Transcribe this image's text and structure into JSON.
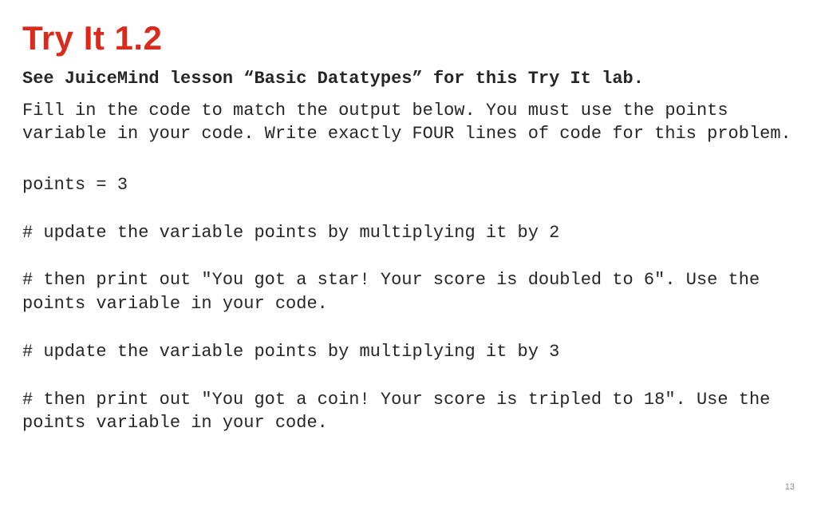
{
  "title": "Try It 1.2",
  "subhead": "See JuiceMind lesson “Basic Datatypes” for this Try It lab.",
  "body": "Fill in the code to match the output below. You must use the points variable in your code. Write exactly FOUR lines of code for this problem.",
  "code": {
    "line1": "points = 3",
    "line2": "# update the variable points by multiplying it by 2",
    "line3": "# then print out \"You got a star! Your score is doubled to 6\". Use the points variable in your code.",
    "line4": "# update the variable points by multiplying it by 3",
    "line5": "# then print out \"You got a coin! Your score is tripled to 18\". Use the points variable in your code."
  },
  "page_number": "13"
}
